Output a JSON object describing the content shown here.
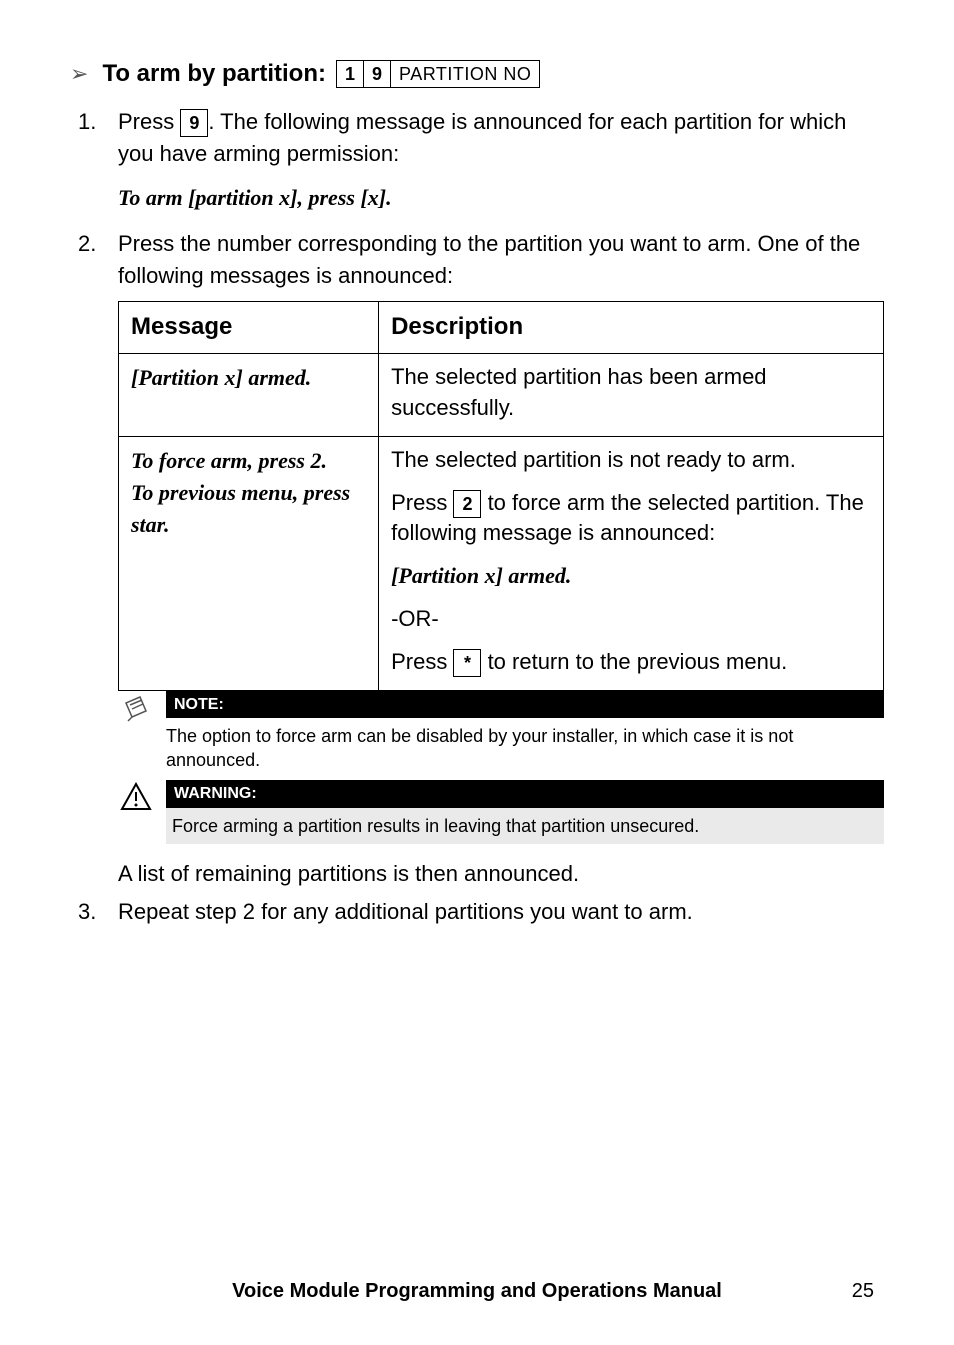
{
  "heading": {
    "label": "To arm by partition:",
    "key1": "1",
    "key2": "9",
    "key3": "PARTITION NO"
  },
  "steps": {
    "s1": {
      "num": "1.",
      "pre": "Press ",
      "key": "9",
      "post": ". The following message is announced for each partition for which you have arming permission:",
      "prompt": "To arm [partition x], press [x]."
    },
    "s2": {
      "num": "2.",
      "text": "Press the number corresponding to the partition you want to arm. One of the following messages is announced:"
    },
    "s3": {
      "num": "3.",
      "text": "Repeat step 2 for any additional partitions you want to arm."
    }
  },
  "table": {
    "h1": "Message",
    "h2": "Description",
    "r1": {
      "msg": "[Partition x] armed.",
      "desc": "The selected partition has been armed successfully."
    },
    "r2": {
      "msg1": "To force arm, press 2.",
      "msg2": "To previous menu, press star.",
      "d1": "The selected partition is not ready to arm.",
      "d2a": "Press ",
      "d2key": "2",
      "d2b": " to force arm the selected partition. The following message is announced:",
      "d3": "[Partition x] armed.",
      "d4": "-OR-",
      "d5a": "Press ",
      "d5key": "*",
      "d5b": " to return to the previous menu."
    }
  },
  "note": {
    "title": "NOTE:",
    "text": "The option to force arm can be disabled by your installer, in which case it is not announced."
  },
  "warning": {
    "title": "WARNING:",
    "text": "Force arming a partition results in leaving that partition unsecured."
  },
  "after": "A list of remaining partitions is then announced.",
  "footer": {
    "title": "Voice Module Programming and Operations Manual",
    "page": "25"
  }
}
